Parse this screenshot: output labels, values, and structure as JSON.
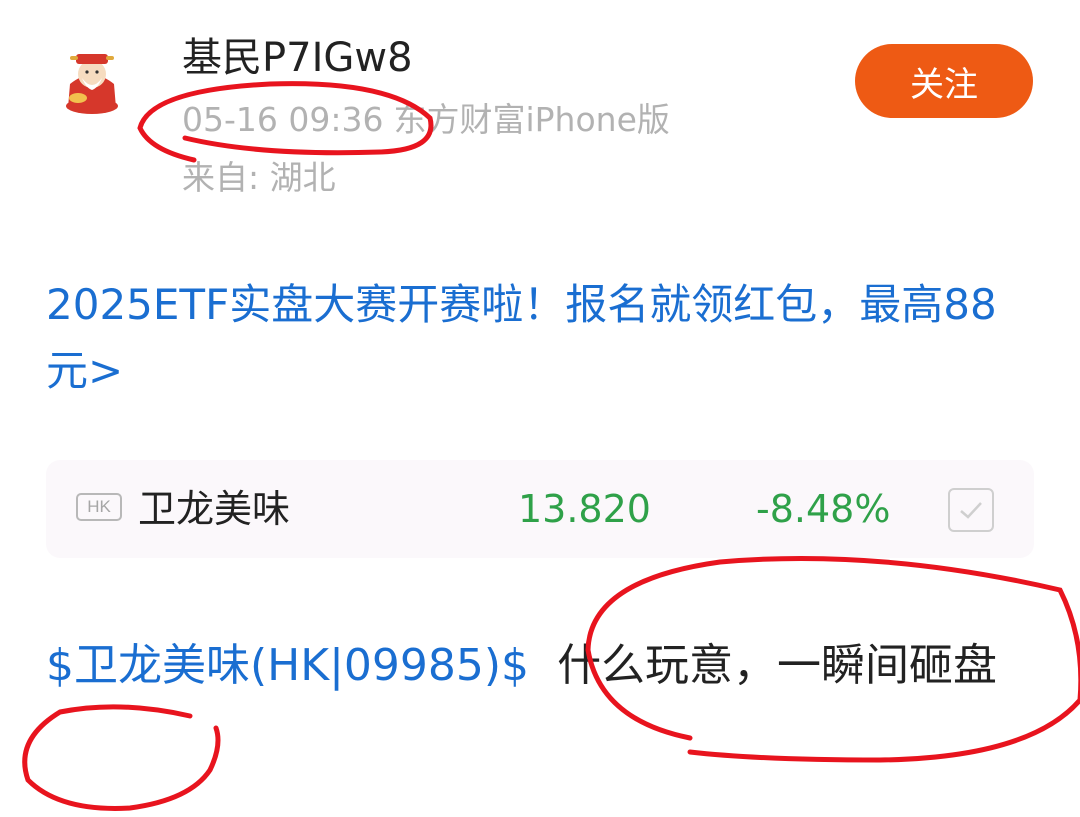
{
  "author": {
    "name": "基民P7IGw8",
    "post_time": "05-16 09:36",
    "source": "东方财富iPhone版",
    "location": "来自: 湖北"
  },
  "follow_button": {
    "label": "关注"
  },
  "promo": {
    "text": "2025ETF实盘大赛开赛啦！报名就领红包，最高88元>"
  },
  "stock_card": {
    "market_badge": "HK",
    "name": "卫龙美味",
    "price": "13.820",
    "change": "-8.48%"
  },
  "post": {
    "stock_tag": "$卫龙美味(HK|09985)$",
    "text": "什么玩意，一瞬间砸盘"
  },
  "colors": {
    "accent_orange": "#ee5a14",
    "link_blue": "#1a6ed1",
    "down_green": "#2fa149",
    "annotation_red": "#e8141e"
  }
}
